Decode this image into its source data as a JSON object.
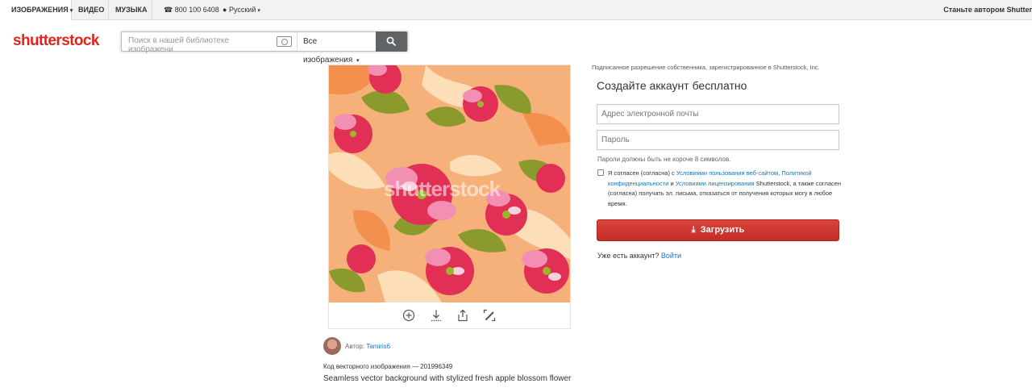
{
  "topbar": {
    "tab_images": "ИЗОБРАЖЕНИЯ",
    "tab_video": "ВИДЕО",
    "tab_music": "МУЗЫКА",
    "phone": "800 100 6408",
    "language": "Русский",
    "contributor": "Станьте автором Shutter"
  },
  "header": {
    "logo": "shutterstock",
    "search_placeholder": "Поиск в нашей библиотеке изображени",
    "search_filter": "Все изображения"
  },
  "image": {
    "watermark": "shutterstock",
    "author_label": "Автор:",
    "author_name": "Tamiris6",
    "code": "Код векторного изображения — 201996349",
    "caption": "Seamless vector background with stylized fresh apple blossom flower"
  },
  "signup": {
    "legal": "Подписанное разрешение собственника, зарегистрированное в Shutterstock, Inc.",
    "title": "Создайте аккаунт бесплатно",
    "email_placeholder": "Адрес электронной почты",
    "password_placeholder": "Пароль",
    "password_hint": "Пароли должны быть не короче 8 символов.",
    "agree_prefix": "Я согласен (согласна) с",
    "terms_link": "Условиями пользования веб-сайтом",
    "privacy_link": "Политикой конфиденциальности",
    "and_text": "и",
    "license_link": "Условиями лицензирования",
    "agree_suffix": "Shutterstock, а также согласен (согласна) получать эл. письма, отказаться от получения которых могу в любое время.",
    "download_label": "Загрузить",
    "have_account": "Уже есть аккаунт?",
    "login_link": "Войти"
  },
  "colors": {
    "brand_red": "#e1241b",
    "link_blue": "#1d74b7",
    "button_red": "#c22d25"
  }
}
